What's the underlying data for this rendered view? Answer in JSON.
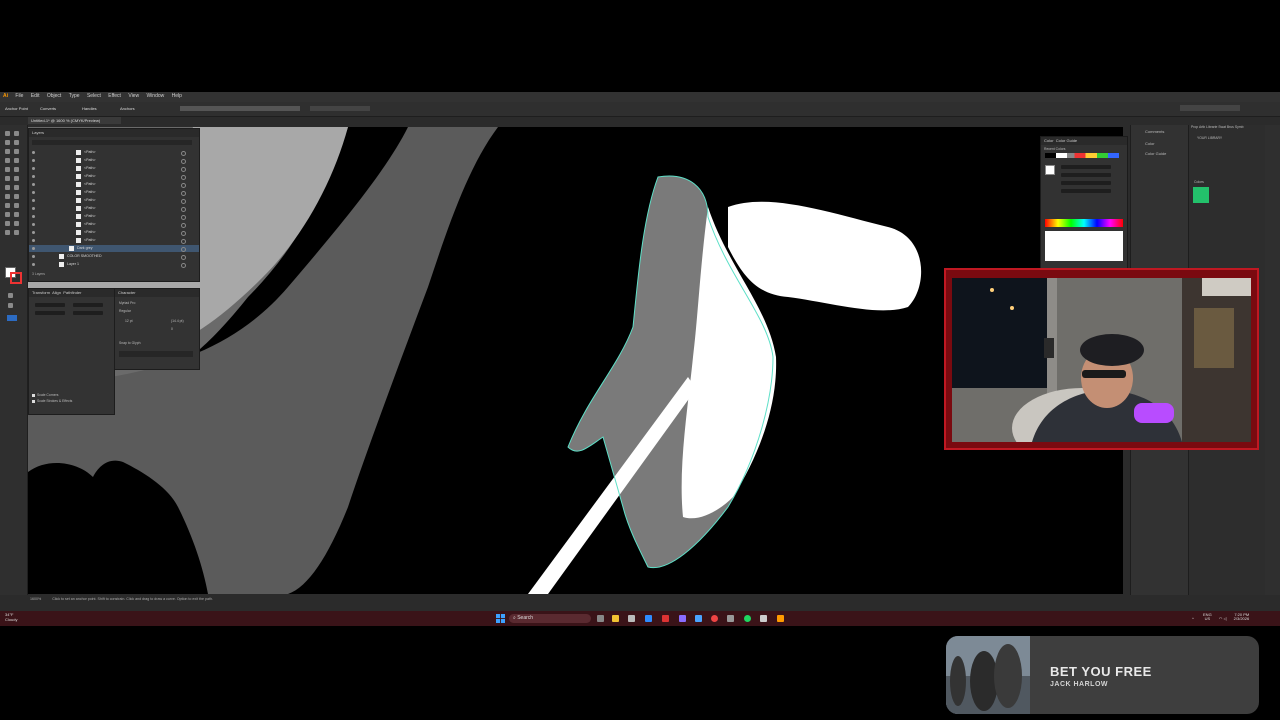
{
  "menu": [
    "File",
    "Edit",
    "Object",
    "Type",
    "Select",
    "Effect",
    "View",
    "Window",
    "Help"
  ],
  "document": {
    "tab_title": "Untitled-1* @ 1600 % (CMYK/Preview)"
  },
  "control_bar": {
    "label": "Anchor Point",
    "converts": "Converts",
    "handles": "Handles",
    "anchors": "Anchors"
  },
  "layers": {
    "tabs": [
      "Layers"
    ],
    "rows": [
      {
        "name": "<Path>"
      },
      {
        "name": "<Path>"
      },
      {
        "name": "<Path>"
      },
      {
        "name": "<Path>"
      },
      {
        "name": "<Path>"
      },
      {
        "name": "<Path>"
      },
      {
        "name": "<Path>"
      },
      {
        "name": "<Path>"
      },
      {
        "name": "<Path>"
      },
      {
        "name": "<Path>"
      },
      {
        "name": "<Path>"
      },
      {
        "name": "<Path>"
      },
      {
        "name": "Dark grey",
        "selected": true
      },
      {
        "name": "COLOR SMOOTHED"
      },
      {
        "name": "Layer 1"
      }
    ],
    "footer": "3 Layers"
  },
  "transform_panel": {
    "tabs": [
      "Transform",
      "Align",
      "Pathfinder"
    ],
    "scale_corners": "Scale Corners",
    "scale_strokes": "Scale Strokes & Effects"
  },
  "character_panel": {
    "tab": "Character",
    "font": "Myriad Pro",
    "style": "Regular",
    "size": "12 pt",
    "leading": "(14.4 pt)",
    "tracking": "0",
    "snap": "Snap to Glyph"
  },
  "color_panel": {
    "tabs": [
      "Color",
      "Color Guide"
    ],
    "recent": "Recent Colors"
  },
  "right_panels": {
    "comments": "Comments",
    "color": "Color",
    "color_guide": "Color Guide"
  },
  "libraries": {
    "tabs": [
      "Prop",
      "Artb",
      "Librarie",
      "Swat",
      "Brus",
      "Symb"
    ],
    "title": "YOUR LIBRARY",
    "colors": "Colors",
    "swatch": "#23c16b"
  },
  "status": {
    "text": "Click to set an anchor point. Shift to constrain. Click and drag to draw a curve. Option to exit the path.",
    "zoom": "1600%"
  },
  "taskbar": {
    "weather_temp": "34°F",
    "weather_desc": "Cloudy",
    "search_placeholder": "Search",
    "tray_lang": "ENG",
    "tray_region": "US",
    "time": "7:20 PM",
    "date": "2/3/2026"
  },
  "music": {
    "title": "BET YOU FREE",
    "artist": "JACK HARLOW"
  },
  "colors": {
    "accent_path": "#5ee0c8",
    "taskbar": "#3a1318",
    "webcam_frame": "#c01822"
  }
}
